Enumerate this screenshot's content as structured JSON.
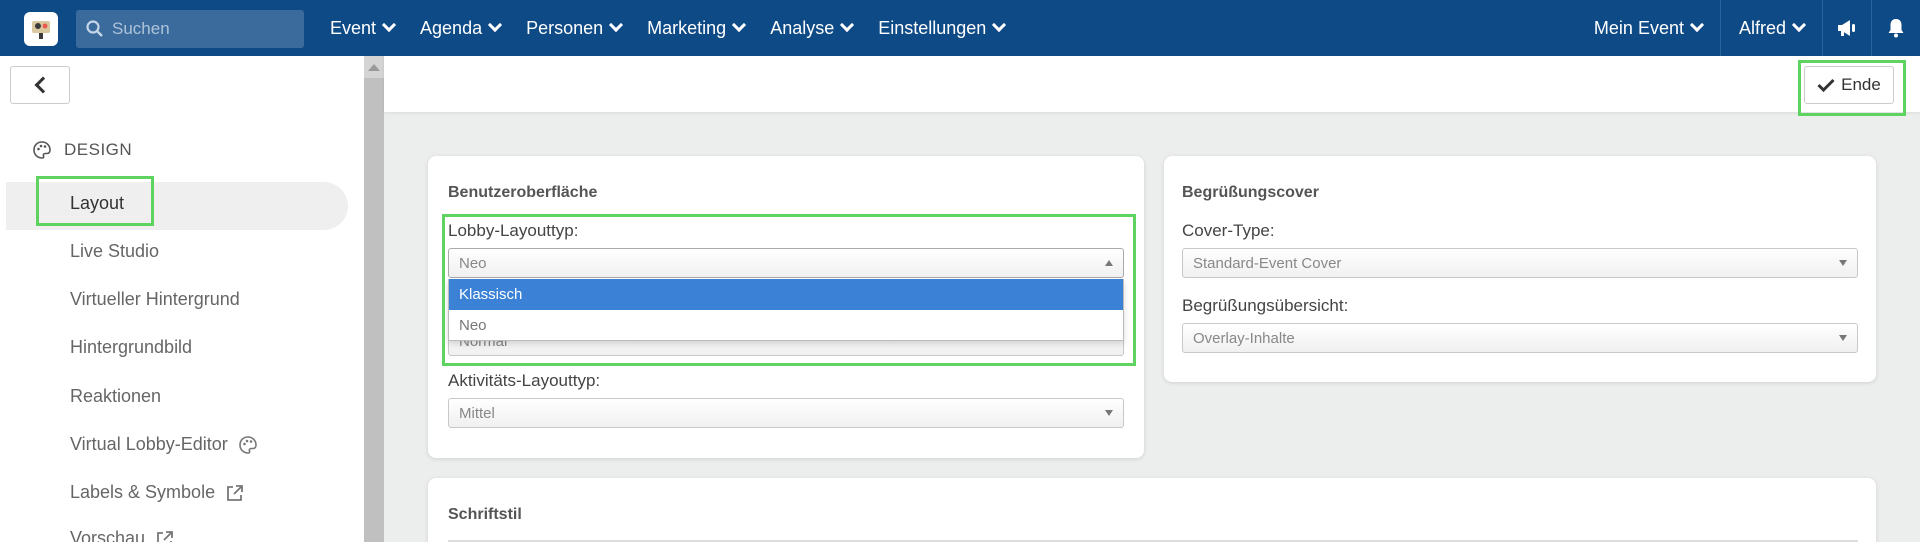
{
  "topbar": {
    "search_placeholder": "Suchen",
    "nav_left": [
      "Event",
      "Agenda",
      "Personen",
      "Marketing",
      "Analyse",
      "Einstellungen"
    ],
    "my_event": "Mein Event",
    "user": "Alfred"
  },
  "sidebar": {
    "section": "DESIGN",
    "items": [
      "Layout",
      "Live Studio",
      "Virtueller Hintergrund",
      "Hintergrundbild",
      "Reaktionen",
      "Virtual Lobby-Editor",
      "Labels & Symbole",
      "Vorschau"
    ]
  },
  "main": {
    "end_button": "Ende",
    "ui_card": {
      "title": "Benutzeroberfläche",
      "lobby_label": "Lobby-Layouttyp:",
      "lobby_value": "Neo",
      "lobby_options": [
        "Klassisch",
        "Neo"
      ],
      "hidden_value": "Normal",
      "activity_label": "Aktivitäts-Layouttyp:",
      "activity_value": "Mittel"
    },
    "cover_card": {
      "title": "Begrüßungscover",
      "cover_type_label": "Cover-Type:",
      "cover_type_value": "Standard-Event Cover",
      "overview_label": "Begrüßungsübersicht:",
      "overview_value": "Overlay-Inhalte"
    },
    "font_card": {
      "title": "Schriftstil"
    }
  },
  "colors": {
    "topbar": "#0e4a86",
    "highlight": "#5fd35f",
    "selected_option": "#3b82d6"
  }
}
